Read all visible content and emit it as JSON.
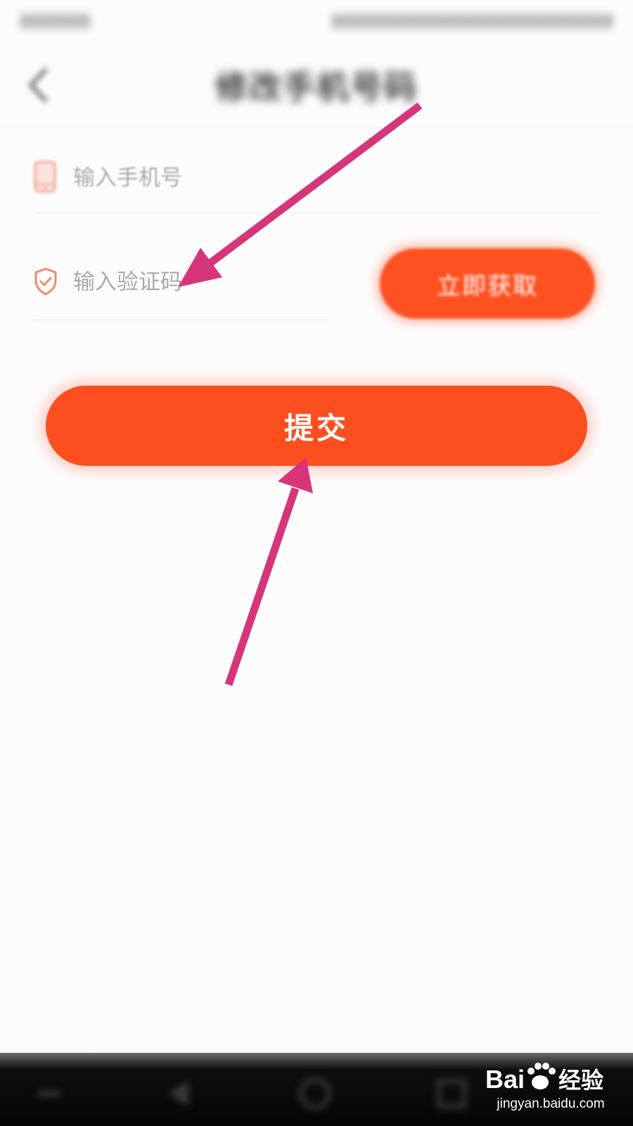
{
  "header": {
    "title": "修改手机号码"
  },
  "form": {
    "phone_placeholder": "输入手机号",
    "code_placeholder": "输入验证码",
    "get_code_label": "立即获取",
    "submit_label": "提交"
  },
  "icons": {
    "back": "chevron-left-icon",
    "phone": "phone-icon",
    "shield": "shield-check-icon"
  },
  "colors": {
    "accent": "#fd5121",
    "arrow": "#d6357a",
    "placeholder": "#aaaaaa"
  },
  "watermark": {
    "brand": "Baidu经验",
    "url": "jingyan.baidu.com"
  }
}
